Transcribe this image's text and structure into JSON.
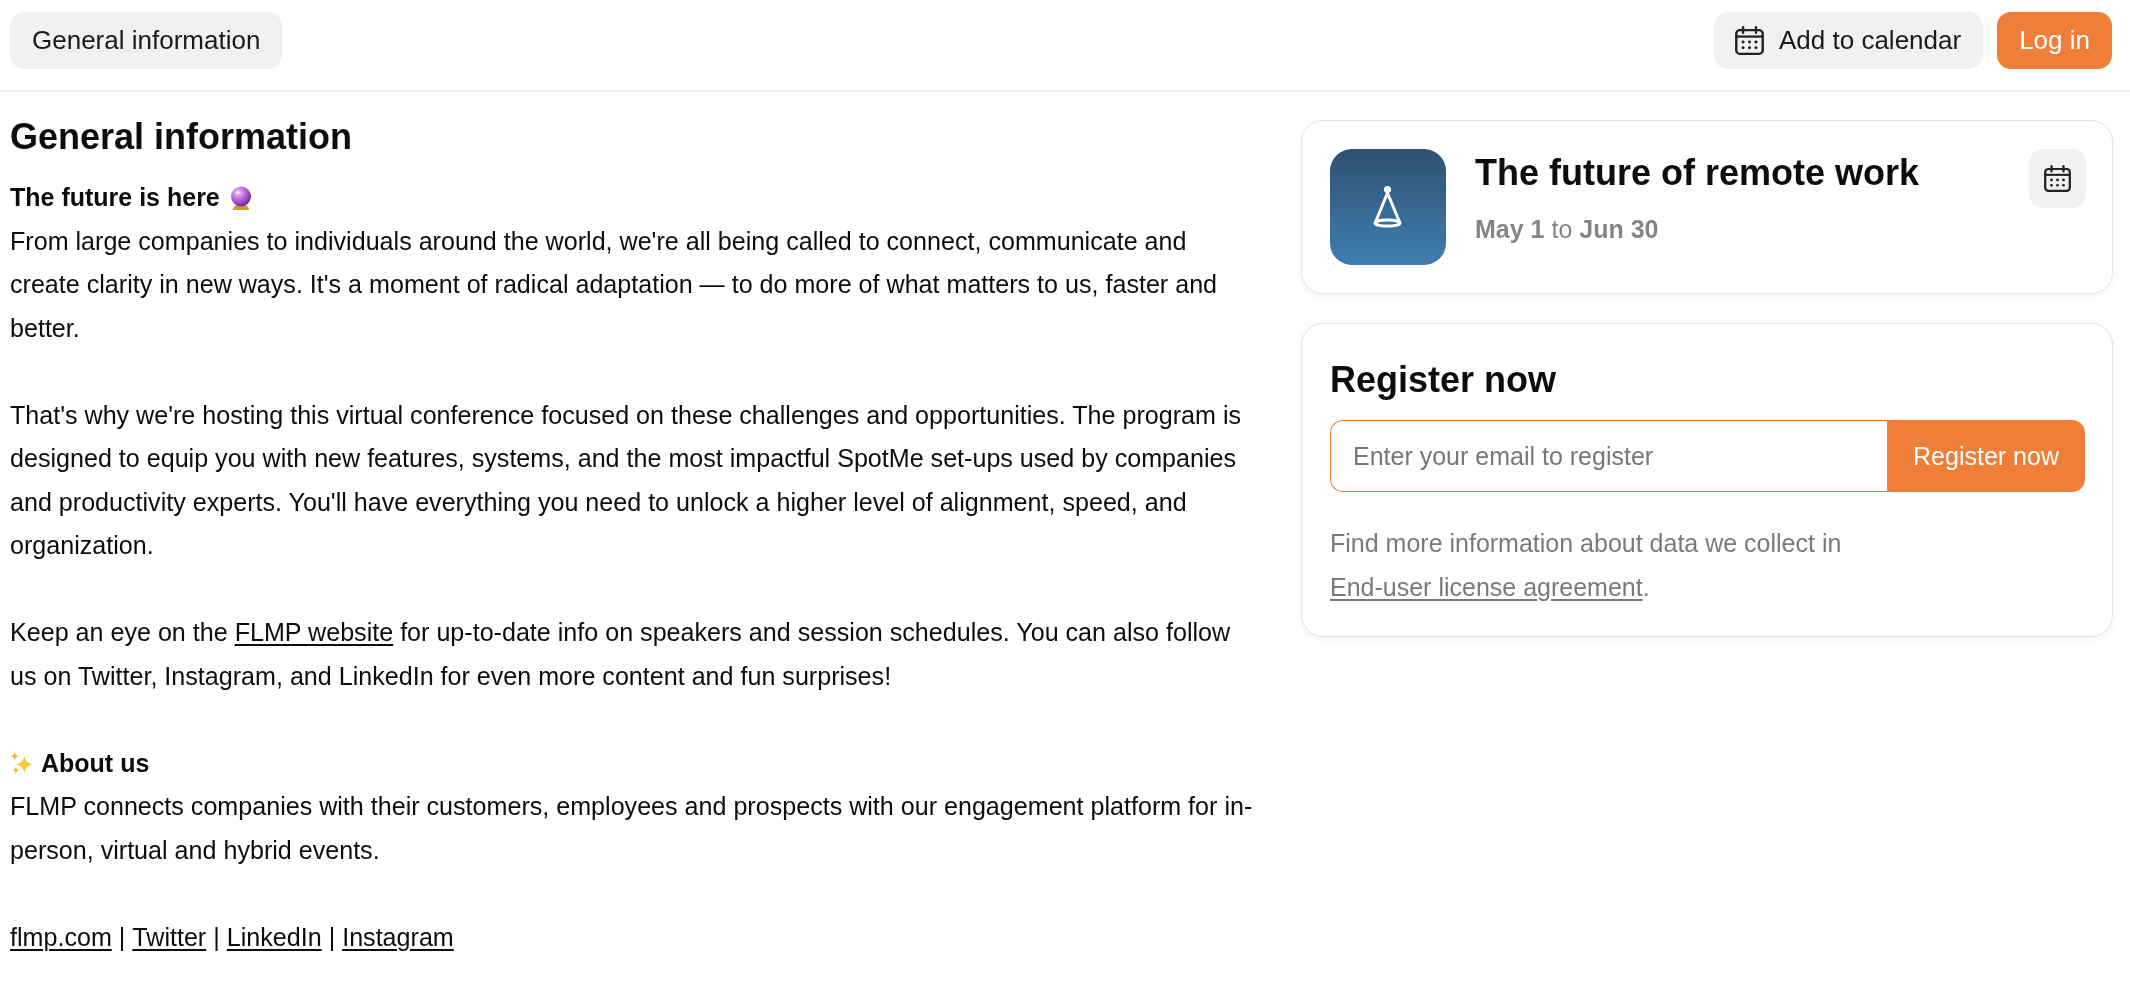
{
  "top_bar": {
    "section_button": "General information",
    "calendar_button": "Add to calendar",
    "login_button": "Log in"
  },
  "content": {
    "heading": "General information",
    "intro": {
      "title": "The future is here",
      "paragraphs": [
        "From large companies to individuals around the world, we're all being called to connect, communicate and create clarity in new ways. It's a moment of radical adaptation — to do more of what matters to us, faster and better.",
        "That's why we're hosting this virtual conference focused on these challenges and opportunities. The program is designed to equip you with new features, systems, and the most impactful SpotMe set-ups used by companies and productivity experts. You'll have everything you need to unlock a higher level of alignment, speed, and organization."
      ],
      "website_note": [
        {
          "kind": "text",
          "text": "Keep an eye on the "
        },
        {
          "kind": "link",
          "text": "FLMP website"
        },
        {
          "kind": "text",
          "text": " for up-to-date info on speakers and session schedules. You can also follow us on Twitter, Instagram, and LinkedIn for even more content and fun surprises!"
        }
      ]
    },
    "about": {
      "title": "About us",
      "paragraph": "FLMP connects companies with their customers, employees and prospects with our engagement platform for in-person, virtual and hybrid events.",
      "links": [
        {
          "kind": "link",
          "text": "flmp.com"
        },
        {
          "kind": "separator",
          "text": "|"
        },
        {
          "kind": "link",
          "text": "Twitter"
        },
        {
          "kind": "separator",
          "text": "|"
        },
        {
          "kind": "link",
          "text": "LinkedIn"
        },
        {
          "kind": "separator",
          "text": "|"
        },
        {
          "kind": "link",
          "text": "Instagram"
        }
      ]
    }
  },
  "event_card": {
    "title": "The future of remote work",
    "dates": "**May 1** to **Jun 30**"
  },
  "register_card": {
    "heading": "Register now",
    "email_field": {
      "placeholder": "Enter your email to register"
    },
    "button": "Register now",
    "note": [
      {
        "kind": "text",
        "text": "Find more information about data we collect in "
      },
      {
        "kind": "link",
        "text": "End-user license agreement"
      },
      {
        "kind": "text",
        "text": "."
      }
    ]
  }
}
